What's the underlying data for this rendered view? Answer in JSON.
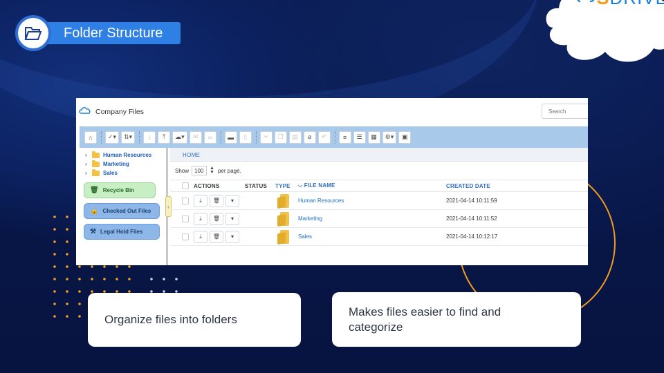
{
  "slide": {
    "title": "Folder Structure",
    "logo": {
      "s": "S",
      "text": "DRIVE"
    },
    "colors": {
      "accent": "#2f80e4",
      "orange": "#f39c1e",
      "background": "#0b1a4a"
    }
  },
  "app": {
    "title": "Company Files",
    "search_placeholder": "Search",
    "toolbar_icons": [
      "home-icon",
      "check-dropdown-icon",
      "sort-dropdown-icon",
      "download-icon",
      "upload-icon",
      "cloud-dropdown-icon",
      "email-icon",
      "link-icon",
      "folder-icon",
      "delete-icon",
      "cut-icon",
      "copy-icon",
      "paste-icon",
      "attach-icon",
      "undo-icon",
      "list-view-icon",
      "detail-view-icon",
      "grid-view-icon",
      "settings-dropdown-icon",
      "info-icon"
    ],
    "tree": [
      {
        "label": "Human Resources"
      },
      {
        "label": "Marketing"
      },
      {
        "label": "Sales"
      }
    ],
    "side_buttons": {
      "recycle": "Recycle Bin",
      "checked_out": "Checked Out Files",
      "legal_hold": "Legal Hold Files"
    },
    "breadcrumb": "HOME",
    "show": {
      "prefix": "Show",
      "value": "100",
      "suffix": "per page."
    },
    "columns": {
      "actions": "ACTIONS",
      "status": "STATUS",
      "type": "TYPE",
      "file_name": "FILE NAME",
      "created_date": "CREATED DATE"
    },
    "rows": [
      {
        "name": "Human Resources",
        "created": "2021-04-14 10:11:59"
      },
      {
        "name": "Marketing",
        "created": "2021-04-14 10:11:52"
      },
      {
        "name": "Sales",
        "created": "2021-04-14 10:12:17"
      }
    ]
  },
  "cards": {
    "left": "Organize files into folders",
    "right": "Makes files easier to find and categorize"
  }
}
